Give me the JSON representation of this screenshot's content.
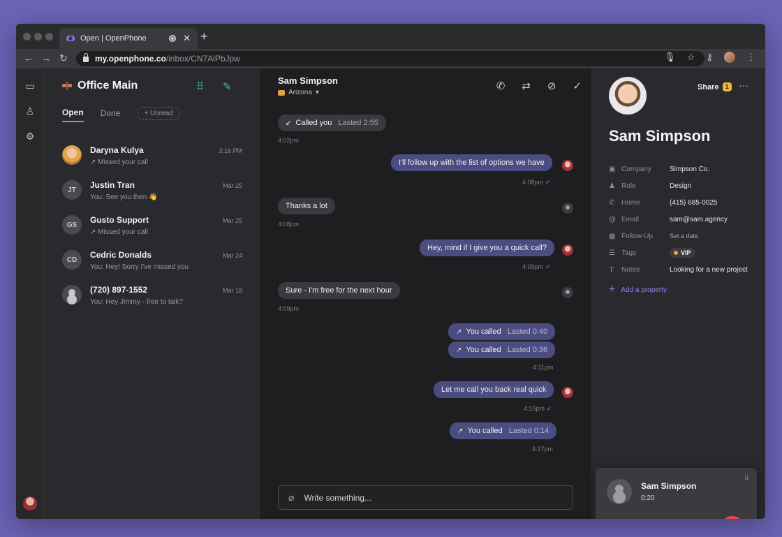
{
  "browser": {
    "tab_title": "Open | OpenPhone",
    "url_domain": "my.openphone.co",
    "url_path": "/inbox/CN7AlPbJpw"
  },
  "inbox": {
    "title": "Office Main",
    "filters": {
      "open": "Open",
      "done": "Done",
      "unread": "+ Unread"
    },
    "conversations": [
      {
        "name": "Daryna Kulya",
        "preview": "↗ Missed your call",
        "time": "3:16 PM",
        "initials": ""
      },
      {
        "name": "Justin Tran",
        "preview": "You: See you then 👋",
        "time": "Mar 25",
        "initials": "JT"
      },
      {
        "name": "Gusto Support",
        "preview": "↗ Missed your call",
        "time": "Mar 25",
        "initials": "GS"
      },
      {
        "name": "Cedric Donalds",
        "preview": "You: Hey! Sorry I've missed you",
        "time": "Mar 24",
        "initials": "CD"
      },
      {
        "name": "(720) 897-1552",
        "preview": "You: Hey Jimmy - free to talk?",
        "time": "Mar 18",
        "initials": ""
      }
    ]
  },
  "chat": {
    "name": "Sam Simpson",
    "location": "Arizona",
    "messages": {
      "m1": {
        "label": "Called you",
        "sub": "Lasted 2:55",
        "time": "4:02pm"
      },
      "m2": {
        "text": "I'll follow up with the list of options we have",
        "time": "4:08pm"
      },
      "m3": {
        "text": "Thanks a lot",
        "time": "4:08pm"
      },
      "m4": {
        "text": "Hey, mind if I give you a quick call?",
        "time": "4:09pm"
      },
      "m5": {
        "text": "Sure - I'm free for the next hour",
        "time": "4:09pm"
      },
      "m6": {
        "label": "You called",
        "sub": "Lasted 0:40"
      },
      "m7": {
        "label": "You called",
        "sub": "Lasted 0:36",
        "time": "4:11pm"
      },
      "m8": {
        "text": "Let me call you back real quick",
        "time": "4:15pm"
      },
      "m9": {
        "label": "You called",
        "sub": "Lasted 0:14",
        "time": "4:17pm"
      }
    },
    "composer_placeholder": "Write something..."
  },
  "contact": {
    "name": "Sam Simpson",
    "share_label": "Share",
    "share_count": "1",
    "props": [
      {
        "key": "Company",
        "value": "Simpson Co."
      },
      {
        "key": "Role",
        "value": "Design"
      },
      {
        "key": "Home",
        "value": "(415) 685-0025"
      },
      {
        "key": "Email",
        "value": "sam@sam.agency"
      },
      {
        "key": "Follow-Up",
        "value": "Set a date"
      },
      {
        "key": "Tags",
        "value": "VIP"
      },
      {
        "key": "Notes",
        "value": "Looking for a new project"
      }
    ],
    "add_property": "Add a property"
  },
  "call": {
    "name": "Sam Simpson",
    "duration": "0:20"
  },
  "colors": {
    "accent_green": "#35c987",
    "outgoing_bubble": "#4b4c80",
    "hangup_red": "#e5484d",
    "link_purple": "#8e84f4"
  }
}
